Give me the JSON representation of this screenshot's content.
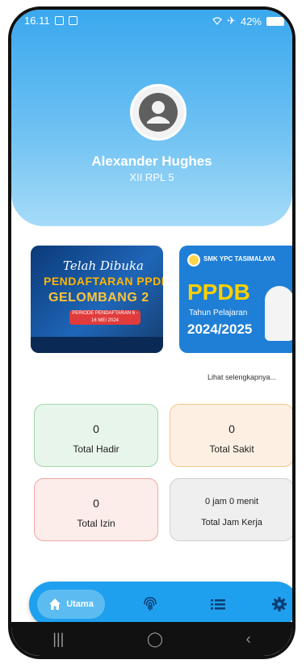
{
  "status_bar": {
    "time": "16.11",
    "battery": "42%"
  },
  "profile": {
    "name": "Alexander Hughes",
    "class": "XII RPL 5"
  },
  "banners": [
    {
      "line1": "Telah Dibuka",
      "line2": "PENDAFTARAN PPDB",
      "line3": "GELOMBANG 2",
      "period": "PERIODE PENDAFTARAN 6 - 16 MEI 2024"
    },
    {
      "school": "SMK YPC TASIMALAYA",
      "title": "PPDB",
      "subtitle": "Tahun Pelajaran",
      "year": "2024/2025"
    }
  ],
  "see_more": "Lihat selengkapnya...",
  "stats": [
    {
      "value": "0",
      "label": "Total Hadir"
    },
    {
      "value": "0",
      "label": "Total Sakit"
    },
    {
      "value": "0",
      "label": "Total Izin"
    },
    {
      "value": "0 jam 0 menit",
      "label": "Total Jam Kerja"
    }
  ],
  "nav": {
    "home_label": "Utama"
  },
  "colors": {
    "primary": "#1ea0ee",
    "hadir": "#9fd6a9",
    "sakit": "#f5c58d",
    "izin": "#f0a8a2"
  }
}
